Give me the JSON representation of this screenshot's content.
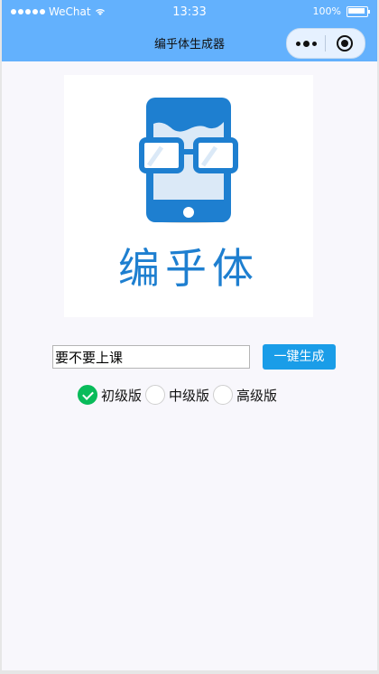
{
  "status_bar": {
    "carrier": "WeChat",
    "time": "13:33",
    "battery": "100%"
  },
  "navbar": {
    "title": "编乎体生成器"
  },
  "logo": {
    "text": "编乎体"
  },
  "form": {
    "input_value": "要不要上课",
    "generate_label": "一键生成",
    "levels": [
      {
        "label": "初级版",
        "checked": true
      },
      {
        "label": "中级版",
        "checked": false
      },
      {
        "label": "高级版",
        "checked": false
      }
    ]
  },
  "colors": {
    "bar": "#63b1fd",
    "button": "#1a9de8",
    "check": "#09bb5a",
    "logo": "#1e7fd0"
  }
}
